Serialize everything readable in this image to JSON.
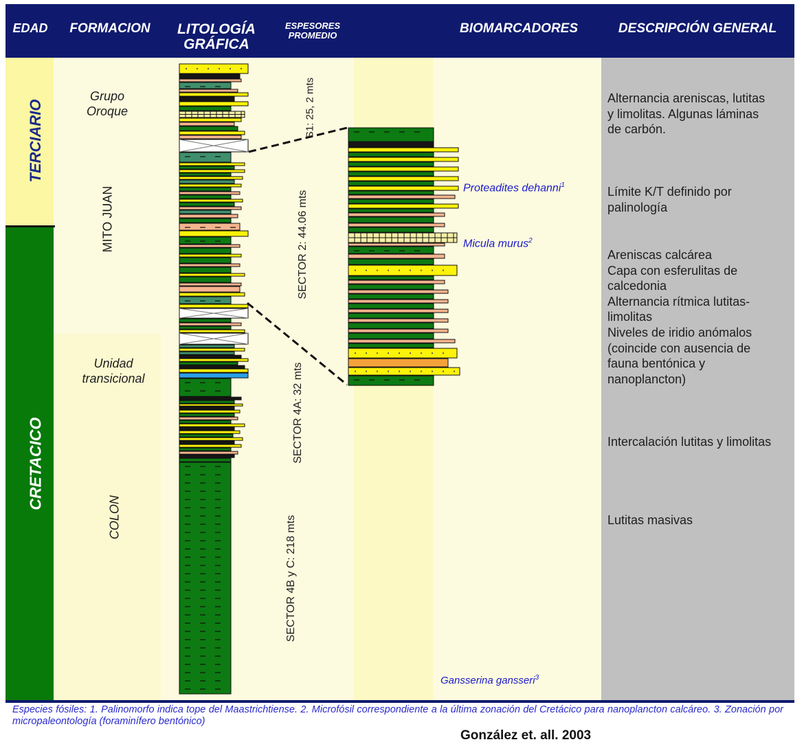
{
  "header": {
    "edad": "EDAD",
    "formacion": "FORMACION",
    "litologia_line1": "LITOLOGÍA",
    "litologia_line2": "GRÁFICA",
    "espesores_line1": "ESPESORES",
    "espesores_line2": "PROMEDIO",
    "biomarcadores": "BIOMARCADORES",
    "descripcion": "DESCRIPCIÓN GENERAL"
  },
  "edad": {
    "terciario": "TERCIARIO",
    "cretacico": "CRETACICO"
  },
  "formaciones": {
    "grupo_oroque_1": "Grupo",
    "grupo_oroque_2": "Oroque",
    "mito_juan": "MITO JUAN",
    "unidad_1": "Unidad",
    "unidad_2": "transicional",
    "colon": "COLON"
  },
  "espesores": {
    "s1": "S1: 25, 2 mts",
    "s2": "SECTOR 2: 44.06 mts",
    "s4a": "SECTOR 4A:  32 mts",
    "s4bc": "SECTOR 4B y C:  218 mts"
  },
  "biomarcadores": {
    "b1_name": "Proteadites dehanni",
    "b1_sup": "1",
    "b2_name": "Micula murus",
    "b2_sup": "2",
    "b3_name": "Gansserina gansseri",
    "b3_sup": "3"
  },
  "descripcion": {
    "d1": [
      "Alternancia areniscas, lutitas",
      "y limolitas. Algunas láminas",
      "de carbón."
    ],
    "d2": [
      "Límite K/T definido por",
      "palinología"
    ],
    "d3": [
      "Areniscas calcárea",
      "Capa con esferulitas de",
      "calcedonia",
      "Alternancia rítmica lutitas-",
      "limolitas",
      "Niveles de iridio anómalos",
      "(coincide con ausencia de",
      "fauna bentónica y",
      "nanoplancton)"
    ],
    "d4": [
      "Intercalación lutitas y limolitas"
    ],
    "d5": [
      "Lutitas  masivas"
    ]
  },
  "footer": {
    "note": "Especies fósiles: 1. Palinomorfo indica tope del Maastrichtiense. 2. Microfósil correspondiente a la última zonación del Cretácico para nanoplancton calcáreo. 3. Zonación por micropaleontología (foraminífero bentónico)",
    "credit": "González et. all. 2003"
  },
  "colors": {
    "header_bg": "#0f1a6e",
    "terciario": "#fcf7a2",
    "cretacico": "#077a0a",
    "cream": "#fdfbdf",
    "description_bg": "#c0c0c0",
    "lutita": "#0d7a12",
    "arenisca": "#fcf20a",
    "limolita_salmon": "#f4b48e",
    "carbon": "#151515",
    "teal": "#3f8f6c",
    "biomarker_text": "#1a1acc"
  }
}
